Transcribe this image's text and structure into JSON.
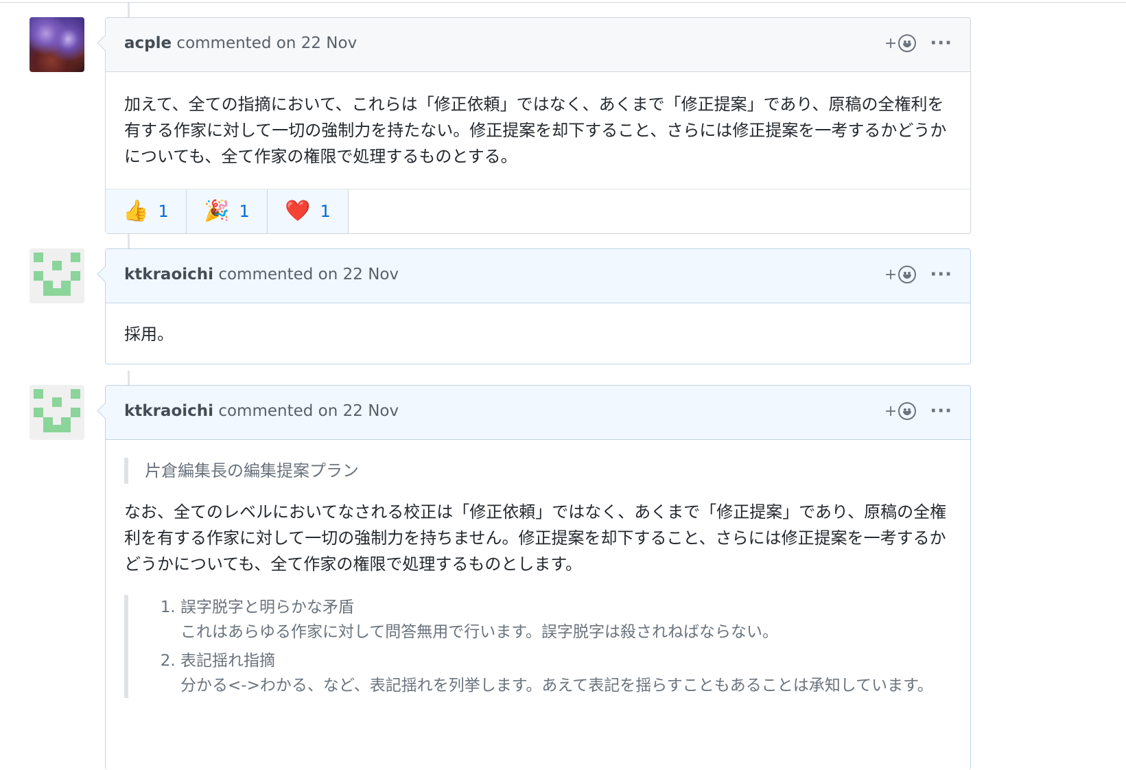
{
  "comments": [
    {
      "author": "acple",
      "meta": "commented on 22 Nov",
      "react_plus": "+",
      "more": "···",
      "body": "加えて、全ての指摘において、これらは「修正依頼」ではなく、あくまで「修正提案」であり、原稿の全権利を有する作家に対して一切の強制力を持たない。修正提案を却下すること、さらには修正提案を一考するかどうかについても、全て作家の権限で処理するものとする。",
      "reactions": [
        {
          "icon": "thumbs-up",
          "glyph": "👍",
          "count": "1"
        },
        {
          "icon": "tada",
          "glyph": "🎉",
          "count": "1"
        },
        {
          "icon": "heart",
          "glyph": "❤️",
          "count": "1"
        }
      ]
    },
    {
      "author": "ktkraoichi",
      "meta": "commented on 22 Nov",
      "react_plus": "+",
      "more": "···",
      "body": "採用。"
    },
    {
      "author": "ktkraoichi",
      "meta": "commented on 22 Nov",
      "react_plus": "+",
      "more": "···",
      "quote": "片倉編集長の編集提案プラン",
      "paragraph": "なお、全てのレベルにおいてなされる校正は「修正依頼」ではなく、あくまで「修正提案」であり、原稿の全権利を有する作家に対して一切の強制力を持ちません。修正提案を却下すること、さらには修正提案を一考するかどうかについても、全て作家の権限で処理するものとします。",
      "list": [
        {
          "title": "誤字脱字と明らかな矛盾",
          "desc": "これはあらゆる作家に対して問答無用で行います。誤字脱字は殺されねばならない。"
        },
        {
          "title": "表記揺れ指摘",
          "desc": "分かる<->わかる、など、表記揺れを列挙します。あえて表記を揺らすこともあることは承知しています。"
        }
      ]
    }
  ]
}
